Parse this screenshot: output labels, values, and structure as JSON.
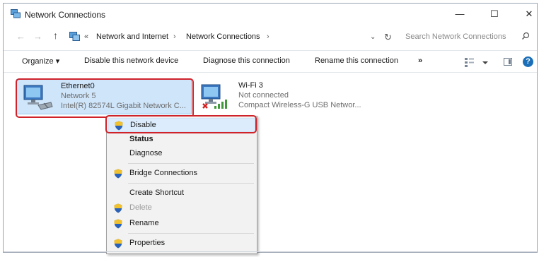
{
  "window": {
    "title": "Network Connections",
    "minimize_glyph": "—",
    "maximize_glyph": "☐",
    "close_glyph": "✕"
  },
  "address_bar": {
    "overflow_glyph": "«",
    "breadcrumbs": [
      "Network and Internet",
      "Network Connections"
    ],
    "separator": "›",
    "search_placeholder": "Search Network Connections"
  },
  "command_bar": {
    "organize": "Organize ▾",
    "disable_device": "Disable this network device",
    "diagnose": "Diagnose this connection",
    "rename": "Rename this connection",
    "more": "»"
  },
  "adapters": [
    {
      "name": "Ethernet0",
      "status": "Network  5",
      "device": "Intel(R) 82574L Gigabit Network C...",
      "selected": true,
      "icon": "ethernet-adapter-icon"
    },
    {
      "name": "Wi-Fi 3",
      "status": "Not connected",
      "device": "Compact Wireless-G USB Networ...",
      "selected": false,
      "icon": "wifi-adapter-icon"
    }
  ],
  "context_menu": {
    "items": [
      {
        "label": "Disable",
        "shield": true,
        "bold": false,
        "disabled": false,
        "selected": true
      },
      {
        "label": "Status",
        "shield": false,
        "bold": true,
        "disabled": false,
        "selected": false
      },
      {
        "label": "Diagnose",
        "shield": false,
        "bold": false,
        "disabled": false,
        "selected": false
      },
      {
        "label": "Bridge Connections",
        "shield": true,
        "bold": false,
        "disabled": false,
        "selected": false
      },
      {
        "label": "Create Shortcut",
        "shield": false,
        "bold": false,
        "disabled": false,
        "selected": false
      },
      {
        "label": "Delete",
        "shield": true,
        "bold": false,
        "disabled": true,
        "selected": false
      },
      {
        "label": "Rename",
        "shield": true,
        "bold": false,
        "disabled": false,
        "selected": false
      },
      {
        "label": "Properties",
        "shield": true,
        "bold": false,
        "disabled": false,
        "selected": false
      }
    ]
  },
  "colors": {
    "selection_fill": "#cfe5fa",
    "highlight_outline": "#cf2229",
    "help_blue": "#1b6fb8"
  }
}
